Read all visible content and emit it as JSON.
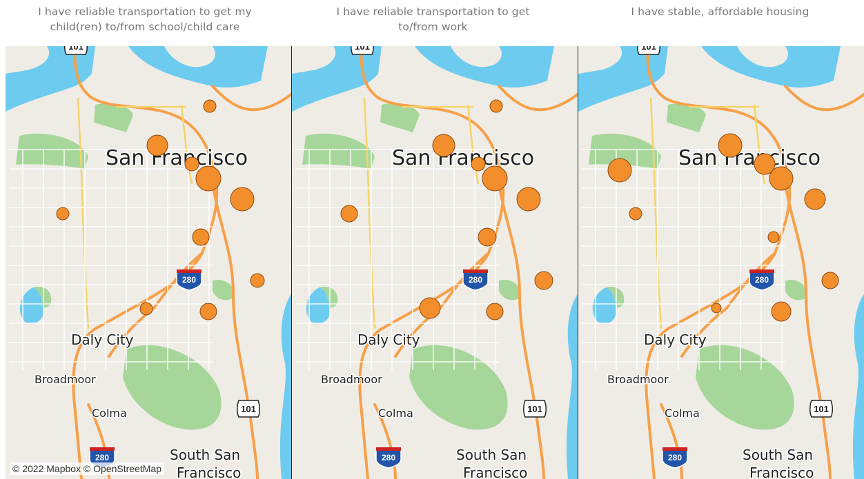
{
  "panels": [
    {
      "title_line1": "I have reliable transportation to get my",
      "title_line2": "child(ren) to/from school/child care",
      "circles": [
        {
          "area": "north",
          "r": 9
        },
        {
          "area": "marina",
          "r": 15
        },
        {
          "area": "nob-hill",
          "r": 10
        },
        {
          "area": "downtown",
          "r": 18
        },
        {
          "area": "soma",
          "r": 17
        },
        {
          "area": "richmond",
          "r": 0
        },
        {
          "area": "sunset",
          "r": 9
        },
        {
          "area": "mission",
          "r": 12
        },
        {
          "area": "noe",
          "r": 0
        },
        {
          "area": "bayview",
          "r": 10
        },
        {
          "area": "excelsior",
          "r": 12
        },
        {
          "area": "ingleside",
          "r": 9
        },
        {
          "area": "lakeshore",
          "r": 0
        }
      ]
    },
    {
      "title_line1": "I have reliable transportation to get",
      "title_line2": "to/from work",
      "circles": [
        {
          "area": "north",
          "r": 9
        },
        {
          "area": "marina",
          "r": 16
        },
        {
          "area": "nob-hill",
          "r": 10
        },
        {
          "area": "downtown",
          "r": 18
        },
        {
          "area": "soma",
          "r": 17
        },
        {
          "area": "richmond",
          "r": 0
        },
        {
          "area": "sunset",
          "r": 12
        },
        {
          "area": "mission",
          "r": 13
        },
        {
          "area": "noe",
          "r": 0
        },
        {
          "area": "bayview",
          "r": 13
        },
        {
          "area": "excelsior",
          "r": 12
        },
        {
          "area": "ingleside",
          "r": 0
        },
        {
          "area": "lakeshore",
          "r": 15
        }
      ]
    },
    {
      "title_line1": "",
      "title_line2": "I have stable, affordable housing",
      "circles": [
        {
          "area": "north",
          "r": 0
        },
        {
          "area": "marina",
          "r": 17
        },
        {
          "area": "nob-hill",
          "r": 15
        },
        {
          "area": "downtown",
          "r": 17
        },
        {
          "area": "soma",
          "r": 15
        },
        {
          "area": "richmond",
          "r": 17
        },
        {
          "area": "sunset",
          "r": 9
        },
        {
          "area": "mission",
          "r": 8
        },
        {
          "area": "noe",
          "r": 0
        },
        {
          "area": "bayview",
          "r": 12
        },
        {
          "area": "excelsior",
          "r": 14
        },
        {
          "area": "ingleside",
          "r": 0
        },
        {
          "area": "lakeshore",
          "r": 7
        }
      ]
    }
  ],
  "map_labels": {
    "city": "San Francisco",
    "daly_city": "Daly City",
    "broadmoor": "Broadmoor",
    "colma": "Colma",
    "south_sf_1": "South San",
    "south_sf_2": "Francisco",
    "shield_101": "101",
    "shield_280": "280"
  },
  "attribution": "© 2022 Mapbox © OpenStreetMap",
  "colors": {
    "water": "#6dcbef",
    "land": "#efece6",
    "park": "#a6d69a",
    "highway": "#f6a04a",
    "arterial": "#f5d36a",
    "marker": "#f28e2b",
    "marker_stroke": "#8a4a13"
  }
}
